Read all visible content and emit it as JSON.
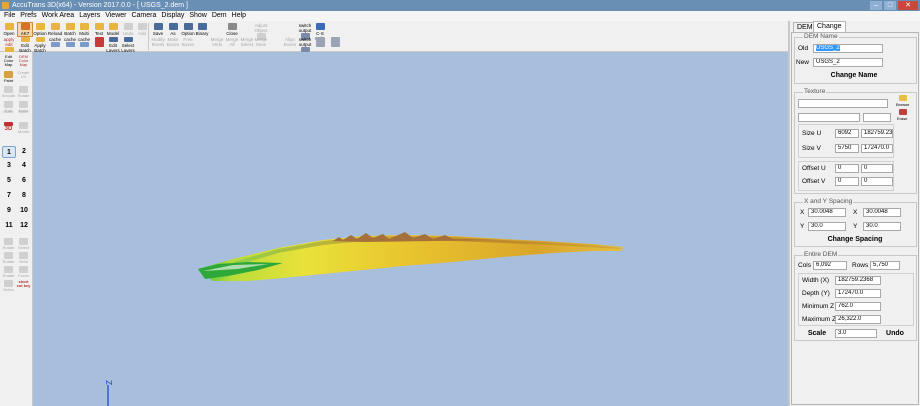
{
  "window": {
    "title": "AccuTrans 3D(x64) - Version 2017.0.0 - [ USGS_2.dem ]"
  },
  "menu": [
    "File",
    "Prefs",
    "Work Area",
    "Layers",
    "Viewer",
    "Camera",
    "Display",
    "Show",
    "Dem",
    "Help"
  ],
  "toolbar": {
    "open": "Open",
    "ak7": "AK7",
    "option": "Option",
    "reload": "Reload",
    "batch": "Batch",
    "multi": "Multi",
    "text": "Text",
    "model": "Model",
    "undo": "Undo",
    "add": "Add",
    "save": "Save",
    "as": "As",
    "save_option": "Option",
    "save_binary": "Binary",
    "close": "Close",
    "adjust_object": "Adjust Object",
    "switch_output": "switch output",
    "cs_help": "C-S Help",
    "apply_edit": "apply edit",
    "edit_batch": "Edit Batch",
    "apply_batch": "Apply Batch",
    "cache1": "cache",
    "cache2": "cache",
    "cache3": "cache",
    "edit_layers": "Edit Layers",
    "select_layers": "Select Layers",
    "modify_boxes": "Modify Boxes",
    "make_boxes": "Make Boxes",
    "free_boxes": "Free Boxes",
    "merge_verts": "Merge Verts",
    "merge_all": "Merge All",
    "merge_select": "Merge Select",
    "merge_save": "Merge Save",
    "align_boxes": "Align Boxes",
    "switch_output2": "switch output"
  },
  "left_tools": {
    "edit_color_map": "Edit Color Map",
    "dem_color_map": "DEM Color Map",
    "paint": "Paint",
    "create_uv": "Create UV",
    "t1": "Smooth",
    "t2": "Rotate",
    "t3": "Edit",
    "t4": "Mode",
    "t5": "Mode",
    "t6": "Mode",
    "tv3d": "3D",
    "t7": "Model",
    "t8": "Rotate",
    "t9": "Select",
    "t10": "Rotate",
    "t11": "Verts",
    "t12": "Rotate",
    "t13": "Faces",
    "t14": "Notes",
    "shortcut": "short cut key"
  },
  "view_buttons": [
    "1",
    "2",
    "3",
    "4",
    "5",
    "6",
    "7",
    "8",
    "9",
    "10",
    "11",
    "12"
  ],
  "viewport": {
    "axis_label": "Z",
    "bg": "#a7bedd"
  },
  "panel": {
    "tabs": [
      "DEM",
      "Change"
    ],
    "dem_name": {
      "title": "DEM Name",
      "old_label": "Old",
      "old_value": "USGS_2",
      "new_label": "New",
      "new_value": "USGS_2",
      "change_name": "Change Name"
    },
    "texture": {
      "title": "Texture",
      "browse": "Browse",
      "erase": "Erase",
      "size_u_label": "Size U",
      "size_u_1": "6092",
      "size_u_2": "182759.236",
      "size_v_label": "Size V",
      "size_v_1": "5750",
      "size_v_2": "172470.0",
      "offset_u_label": "Offset U",
      "offset_u_1": "0",
      "offset_u_2": "0",
      "offset_v_label": "Offset V",
      "offset_v_1": "0",
      "offset_v_2": "0"
    },
    "spacing": {
      "title": "X and Y Spacing",
      "x_label": "X",
      "x1": "30.0048",
      "x2": "30.0048",
      "y_label": "Y",
      "y1": "30.0",
      "y2": "30.0",
      "change_spacing": "Change Spacing"
    },
    "entire": {
      "title": "Entire DEM",
      "cols_label": "Cols",
      "cols": "6,092",
      "rows_label": "Rows",
      "rows": "5,750",
      "width_label": "Width (X)",
      "width": "182759.2368",
      "depth_label": "Depth (Y)",
      "depth": "172470.0",
      "minz_label": "Minimum Z",
      "minz": "762.0",
      "maxz_label": "Maximum Z",
      "maxz": "26,322.0",
      "scale_label": "Scale",
      "scale": "3.0",
      "undo": "Undo"
    }
  }
}
